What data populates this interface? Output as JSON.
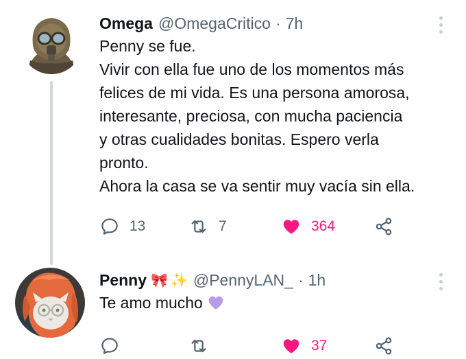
{
  "tweets": [
    {
      "display_name": "Omega",
      "handle": "@OmegaCritico",
      "separator": "·",
      "time": "7h",
      "lines": [
        "Penny se fue.",
        "Vivir con ella fue uno de los momentos más",
        "felices de mi vida. Es una persona amorosa,",
        "interesante, preciosa, con mucha paciencia",
        "y otras cualidades bonitas. Espero verla",
        "pronto.",
        "Ahora la casa se va sentir muy vacía sin ella."
      ],
      "reply_count": "13",
      "retweet_count": "7",
      "like_count": "364",
      "liked": true,
      "avatar_icon": "gas-mask-character"
    },
    {
      "display_name": "Penny",
      "name_emojis": [
        "🎀",
        "✨"
      ],
      "handle": "@PennyLAN_",
      "separator": "·",
      "time": "1h",
      "text": "Te amo mucho",
      "text_emoji": "purple-heart",
      "reply_count": "",
      "retweet_count": "",
      "like_count": "37",
      "liked": true,
      "avatar_icon": "cat-with-glasses"
    }
  ],
  "colors": {
    "like_active": "#f91880",
    "icon_gray": "#536471",
    "thread_line": "#cfd9de",
    "purple_heart": "#b59ee6"
  }
}
